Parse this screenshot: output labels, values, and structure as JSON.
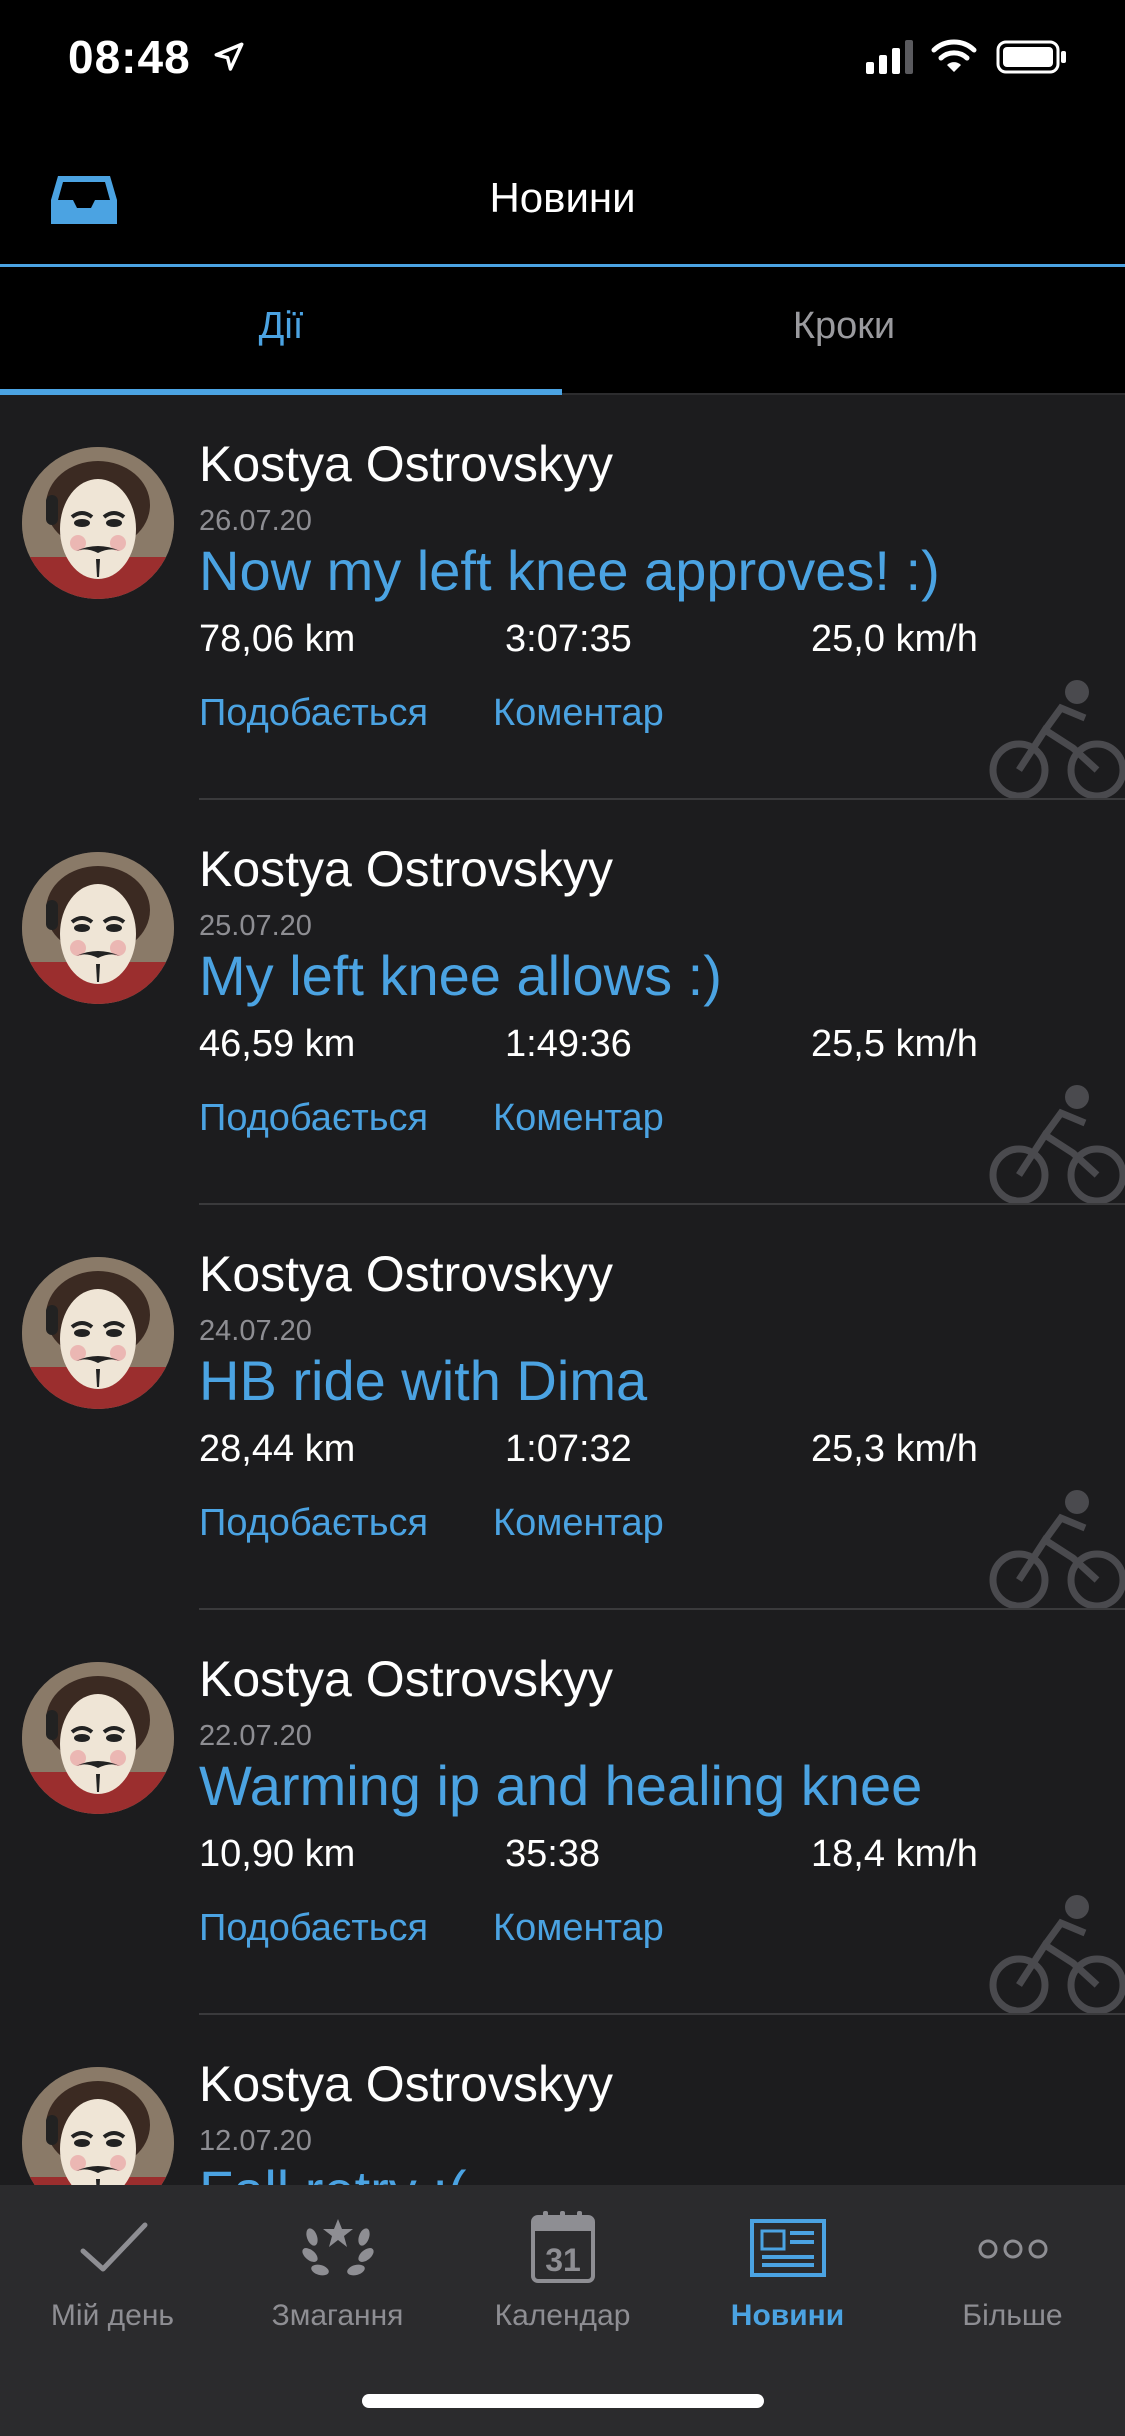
{
  "status_bar": {
    "time": "08:48"
  },
  "header": {
    "title": "Новини",
    "icon": "inbox-icon"
  },
  "tabs": [
    {
      "label": "Дії",
      "active": true
    },
    {
      "label": "Кроки",
      "active": false
    }
  ],
  "feed": [
    {
      "user": "Kostya Ostrovskyy",
      "date": "26.07.20",
      "title": "Now my left knee approves! :)",
      "distance": "78,06 km",
      "duration": "3:07:35",
      "speed": "25,0 km/h",
      "like_label": "Подобається",
      "comment_label": "Коментар",
      "activity_icon": "cycling-icon"
    },
    {
      "user": "Kostya Ostrovskyy",
      "date": "25.07.20",
      "title": "My left knee allows :)",
      "distance": "46,59 km",
      "duration": "1:49:36",
      "speed": "25,5 km/h",
      "like_label": "Подобається",
      "comment_label": "Коментар",
      "activity_icon": "cycling-icon"
    },
    {
      "user": "Kostya Ostrovskyy",
      "date": "24.07.20",
      "title": "HB ride with Dima",
      "distance": "28,44 km",
      "duration": "1:07:32",
      "speed": "25,3 km/h",
      "like_label": "Подобається",
      "comment_label": "Коментар",
      "activity_icon": "cycling-icon"
    },
    {
      "user": "Kostya Ostrovskyy",
      "date": "22.07.20",
      "title": "Warming ip and healing knee",
      "distance": "10,90 km",
      "duration": "35:38",
      "speed": "18,4 km/h",
      "like_label": "Подобається",
      "comment_label": "Коментар",
      "activity_icon": "cycling-icon"
    },
    {
      "user": "Kostya Ostrovskyy",
      "date": "12.07.20",
      "title": "Fall retry :(",
      "distance": "",
      "duration": "",
      "speed": "",
      "like_label": "",
      "comment_label": "",
      "activity_icon": ""
    }
  ],
  "bottom_nav": [
    {
      "label": "Мій день",
      "icon": "checkmark-icon",
      "active": false
    },
    {
      "label": "Змагання",
      "icon": "laurel-icon",
      "active": false
    },
    {
      "label": "Календар",
      "icon": "calendar-icon",
      "active": false,
      "day": "31"
    },
    {
      "label": "Новини",
      "icon": "newsfeed-icon",
      "active": true
    },
    {
      "label": "Більше",
      "icon": "more-icon",
      "active": false
    }
  ],
  "colors": {
    "accent": "#4ba3e2",
    "background": "#1c1c1e",
    "bar": "#000000",
    "nav": "#2b2b2d",
    "muted": "#8e8e93"
  }
}
